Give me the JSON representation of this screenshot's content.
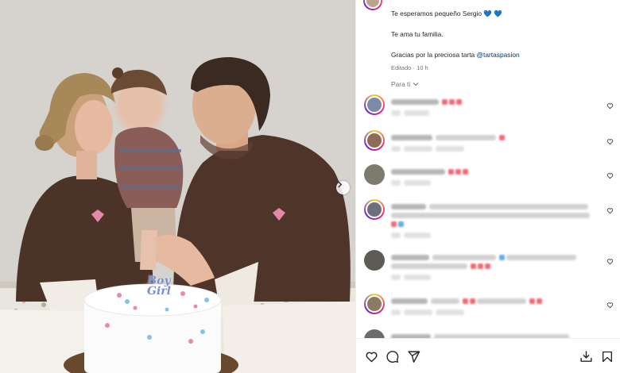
{
  "caption": {
    "line1": "Te esperamos pequeño Sergio",
    "line1_emoji": "💙 💙",
    "line2": "Te ama tu familia.",
    "line3": "Gracias por la preciosa tarta",
    "mention": "@tartaspasion",
    "edited": "Editado · 10 h"
  },
  "sort_label": "Para ti",
  "cake_topper": "Boy\nGirl",
  "comments": [
    {
      "avatar": "#7b8aa6"
    },
    {
      "avatar": "#8f6c5a"
    },
    {
      "avatar": "#7d7a6e"
    },
    {
      "avatar": "#6d6f7c"
    },
    {
      "avatar": "#5e5a55"
    },
    {
      "avatar": "#8c7b62"
    },
    {
      "avatar": "#6c6c6c"
    }
  ],
  "icons": [
    "carousel-next-icon",
    "like-icon",
    "comment-icon",
    "share-icon",
    "repost-icon",
    "save-icon",
    "comment-like-icon",
    "chevron-down-icon"
  ],
  "colors": {
    "mention": "#00376b",
    "secondary": "#737373",
    "hearts": "#3b8fd6",
    "sweater": "#4b3328"
  }
}
